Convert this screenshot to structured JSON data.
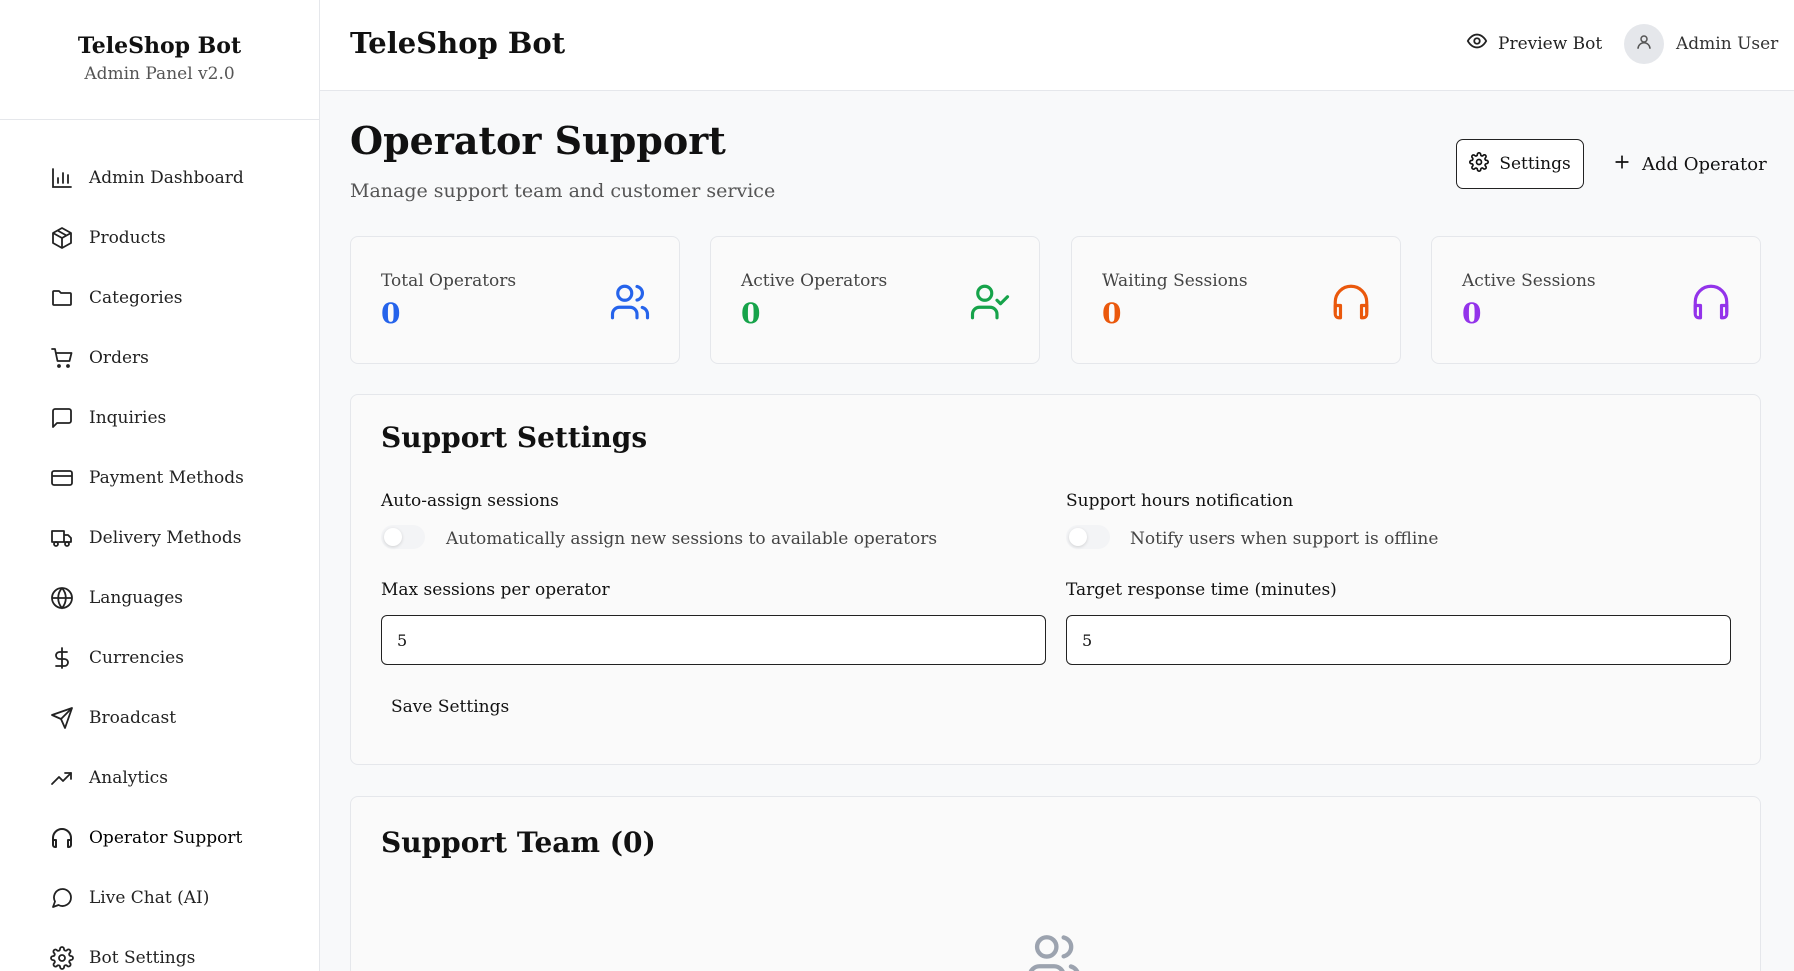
{
  "brand": {
    "title": "TeleShop Bot",
    "subtitle": "Admin Panel v2.0"
  },
  "sidebar": {
    "items": [
      {
        "label": "Admin Dashboard",
        "icon": "bar-chart-icon"
      },
      {
        "label": "Products",
        "icon": "package-icon"
      },
      {
        "label": "Categories",
        "icon": "folder-icon"
      },
      {
        "label": "Orders",
        "icon": "cart-icon"
      },
      {
        "label": "Inquiries",
        "icon": "message-square-icon"
      },
      {
        "label": "Payment Methods",
        "icon": "credit-card-icon"
      },
      {
        "label": "Delivery Methods",
        "icon": "truck-icon"
      },
      {
        "label": "Languages",
        "icon": "globe-icon"
      },
      {
        "label": "Currencies",
        "icon": "dollar-icon"
      },
      {
        "label": "Broadcast",
        "icon": "send-icon"
      },
      {
        "label": "Analytics",
        "icon": "trending-up-icon"
      },
      {
        "label": "Operator Support",
        "icon": "headphones-icon",
        "active": true
      },
      {
        "label": "Live Chat (AI)",
        "icon": "message-circle-icon"
      },
      {
        "label": "Bot Settings",
        "icon": "gear-icon"
      }
    ]
  },
  "header": {
    "title": "TeleShop Bot",
    "preview_label": "Preview Bot",
    "user_name": "Admin User"
  },
  "page": {
    "title": "Operator Support",
    "subtitle": "Manage support team and customer service",
    "settings_label": "Settings",
    "add_operator_label": "Add Operator"
  },
  "stats": [
    {
      "label": "Total Operators",
      "value": "0",
      "color": "#2563eb",
      "icon": "users-icon"
    },
    {
      "label": "Active Operators",
      "value": "0",
      "color": "#16a34a",
      "icon": "user-check-icon"
    },
    {
      "label": "Waiting Sessions",
      "value": "0",
      "color": "#ea580c",
      "icon": "headphones-icon"
    },
    {
      "label": "Active Sessions",
      "value": "0",
      "color": "#9333ea",
      "icon": "headphones-icon"
    }
  ],
  "support_settings": {
    "title": "Support Settings",
    "auto_assign": {
      "label": "Auto-assign sessions",
      "description": "Automatically assign new sessions to available operators",
      "enabled": false
    },
    "hours_notification": {
      "label": "Support hours notification",
      "description": "Notify users when support is offline",
      "enabled": false
    },
    "max_sessions": {
      "label": "Max sessions per operator",
      "value": "5"
    },
    "target_response": {
      "label": "Target response time (minutes)",
      "value": "5"
    },
    "save_label": "Save Settings"
  },
  "support_team": {
    "title": "Support Team (0)",
    "empty_icon": "users-icon"
  }
}
